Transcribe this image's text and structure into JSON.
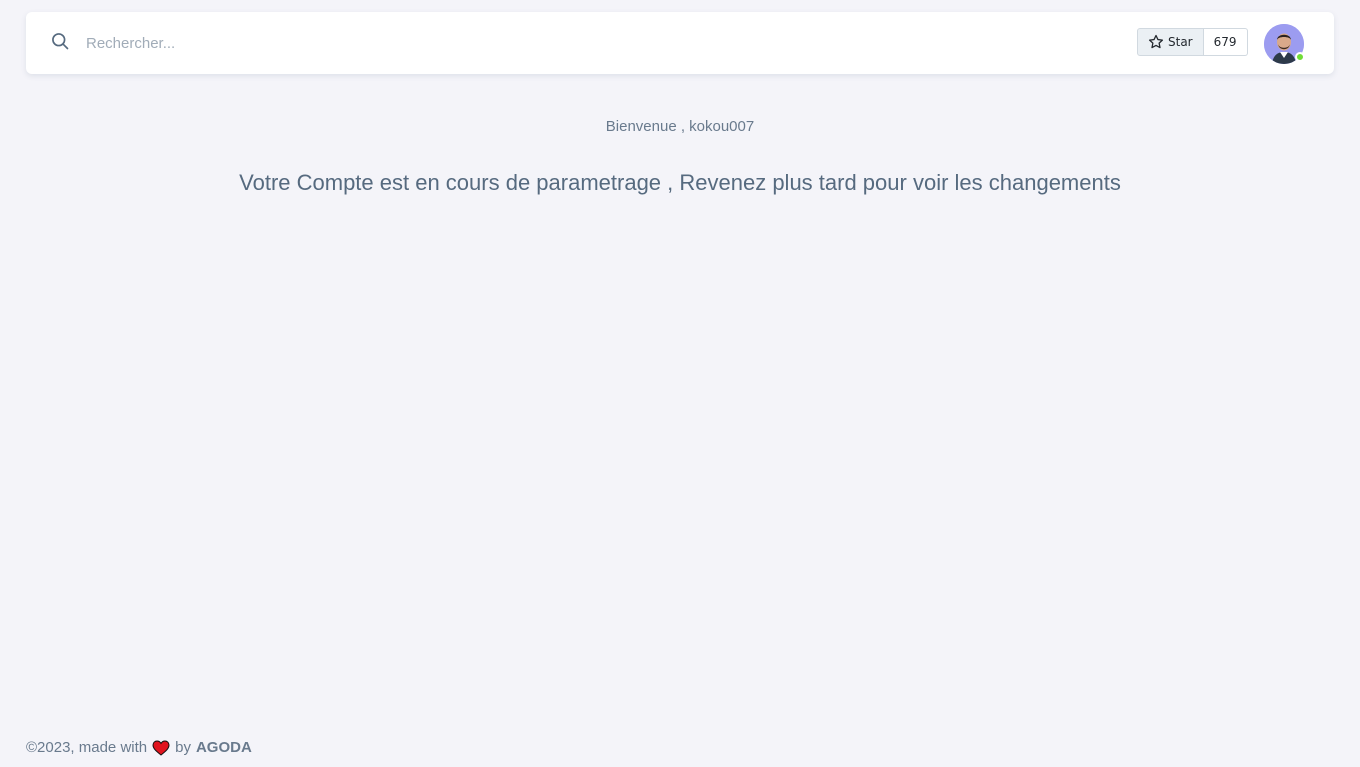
{
  "search": {
    "placeholder": "Rechercher...",
    "icon": "search-icon"
  },
  "github_star": {
    "label": "Star",
    "count": "679",
    "icon": "star-icon"
  },
  "user": {
    "status_color": "#71dd37"
  },
  "main": {
    "welcome_prefix": "Bienvenue , kokou007",
    "message": "Votre Compte est en cours de parametrage , Revenez plus tard pour voir les changements"
  },
  "footer": {
    "prefix": "©2023, made with",
    "middle": "by",
    "brand": "AGODA",
    "heart_color": "#e0141e"
  },
  "colors": {
    "background": "#f4f4f9",
    "text": "#566a7f",
    "card": "#ffffff"
  }
}
